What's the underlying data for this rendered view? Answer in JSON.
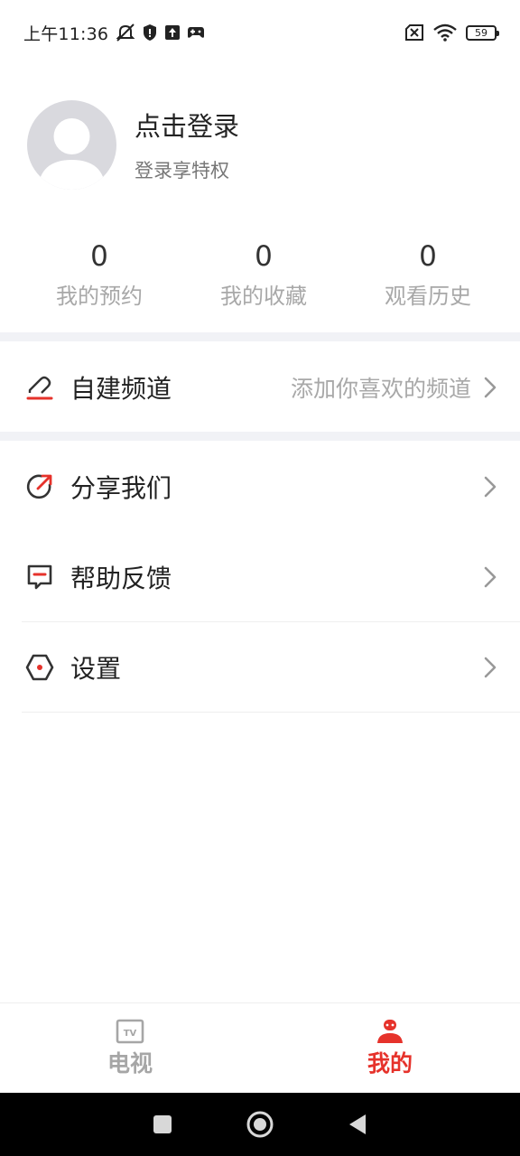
{
  "status_bar": {
    "time": "上午11:36",
    "battery": "59"
  },
  "profile": {
    "title": "点击登录",
    "subtitle": "登录享特权"
  },
  "stats": [
    {
      "value": "0",
      "label": "我的预约"
    },
    {
      "value": "0",
      "label": "我的收藏"
    },
    {
      "value": "0",
      "label": "观看历史"
    }
  ],
  "custom_channel": {
    "label": "自建频道",
    "hint": "添加你喜欢的频道"
  },
  "menu": [
    {
      "label": "分享我们"
    },
    {
      "label": "帮助反馈"
    },
    {
      "label": "设置"
    }
  ],
  "bottom_nav": [
    {
      "label": "电视"
    },
    {
      "label": "我的"
    }
  ],
  "colors": {
    "accent": "#e6322b",
    "muted": "#a8a8a8",
    "separator": "#f1f2f6"
  }
}
